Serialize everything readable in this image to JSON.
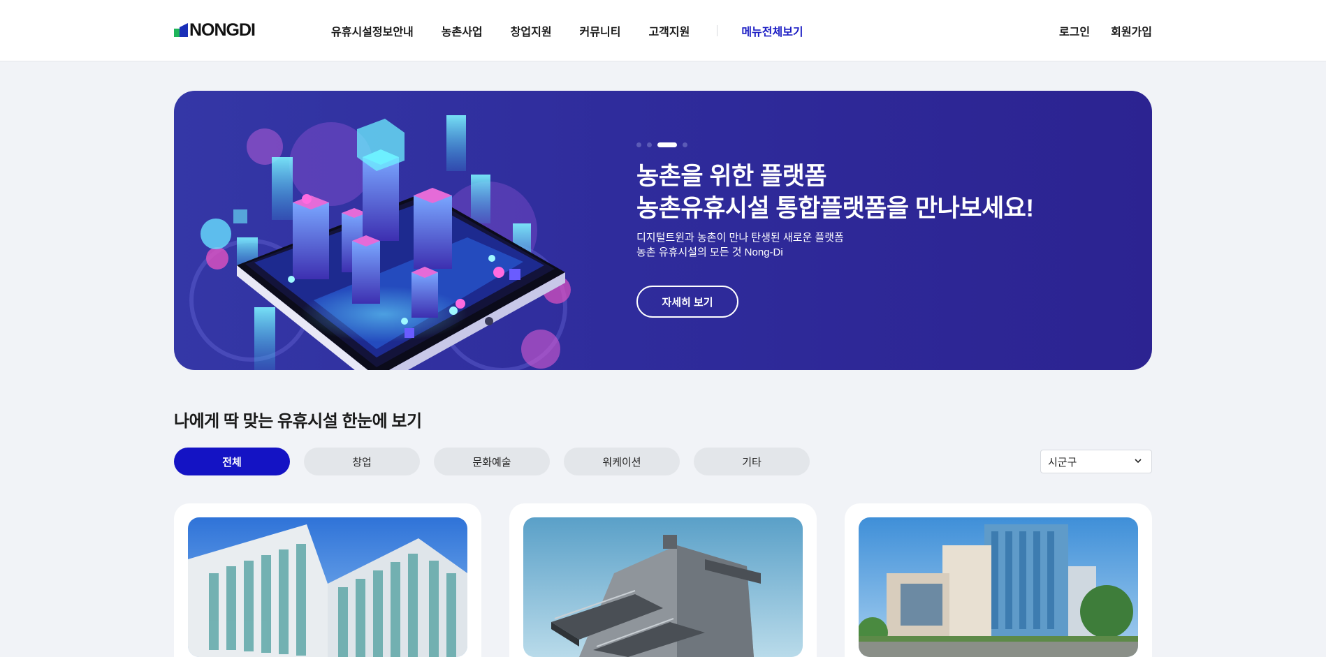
{
  "header": {
    "logo": "NONGDI",
    "nav": [
      "유휴시설정보안내",
      "농촌사업",
      "창업지원",
      "커뮤니티",
      "고객지원"
    ],
    "all_menu": "메뉴전체보기",
    "login": "로그인",
    "signup": "회원가입"
  },
  "hero": {
    "title_line1": "농촌을 위한 플랫폼",
    "title_line2": "농촌유휴시설 통합플랫폼을 만나보세요!",
    "sub_line1": "디지털트윈과 농촌이 만나 탄생된 새로운 플랫폼",
    "sub_line2": "농촌 유휴시설의 모든 것 Nong-Di",
    "button": "자세히 보기",
    "slide_count": 4,
    "active_slide": 3
  },
  "section": {
    "title": "나에게 딱 맞는 유휴시설 한눈에 보기",
    "filters": [
      "전체",
      "창업",
      "문화예술",
      "워케이션",
      "기타"
    ],
    "active_filter": "전체",
    "region_select": "시군구"
  },
  "colors": {
    "accent": "#1413c4",
    "hero_bg": "#2f2c9c",
    "chip_bg": "#e3e6ea",
    "page_bg": "#f1f3f7"
  }
}
